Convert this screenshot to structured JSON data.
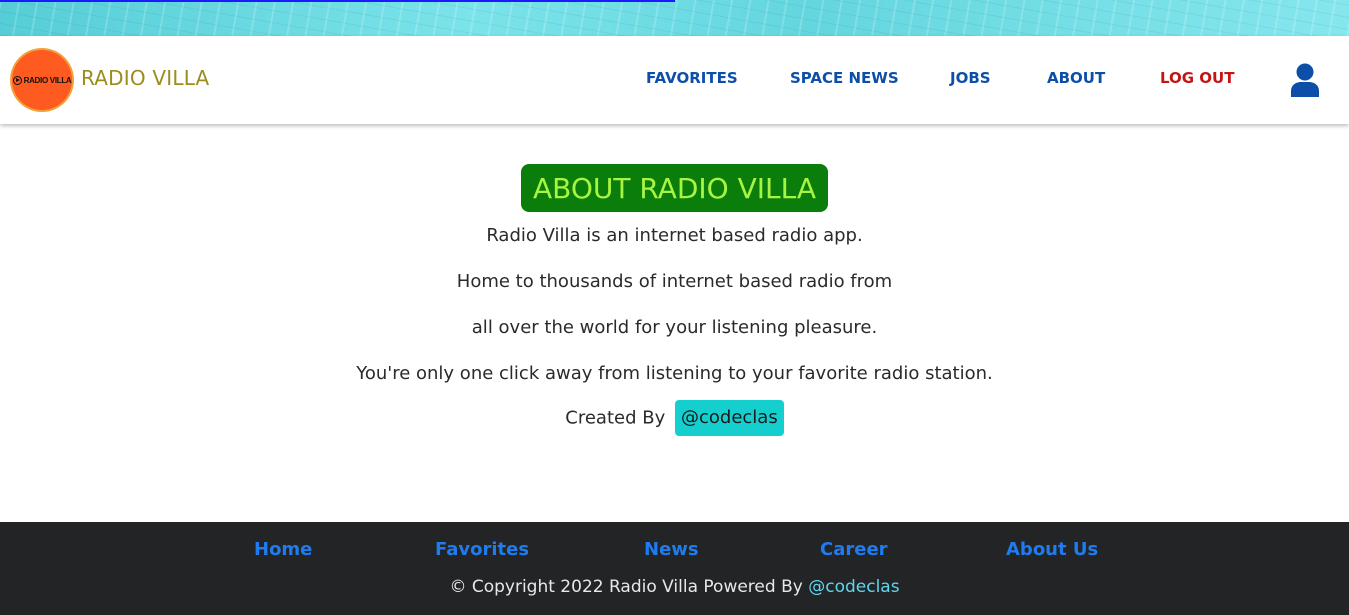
{
  "banner": {
    "progress_fraction": 0.5
  },
  "header": {
    "logo_text": "RADIO VILLA",
    "brand": "RADIO VILLA",
    "nav": {
      "favorites": "FAVORITES",
      "space_news": "SPACE NEWS",
      "jobs": "JOBS",
      "about": "ABOUT",
      "logout": "LOG OUT"
    },
    "user_icon": "user-icon"
  },
  "main": {
    "title": "ABOUT RADIO VILLA",
    "paragraphs": [
      "Radio Villa is an internet based radio app.",
      "Home to thousands of internet based radio from",
      "all over the world for your listening pleasure.",
      "You're only one click away from listening to your favorite radio station."
    ],
    "created_by_label": "Created By",
    "created_by_handle": "@codeclas"
  },
  "footer": {
    "links": {
      "home": "Home",
      "favorites": "Favorites",
      "news": "News",
      "career": "Career",
      "about_us": "About Us"
    },
    "copyright_text": "© Copyright 2022 Radio Villa Powered By",
    "powered_by_handle": "@codeclas"
  },
  "colors": {
    "brand_gold": "#9a8d1e",
    "nav_blue": "#0d4fa8",
    "logout_red": "#c41414",
    "title_bg": "#0b7d0b",
    "title_text": "#a7f542",
    "handle_badge": "#15cfcf",
    "footer_bg": "#232425",
    "footer_link": "#1e7cf0"
  }
}
